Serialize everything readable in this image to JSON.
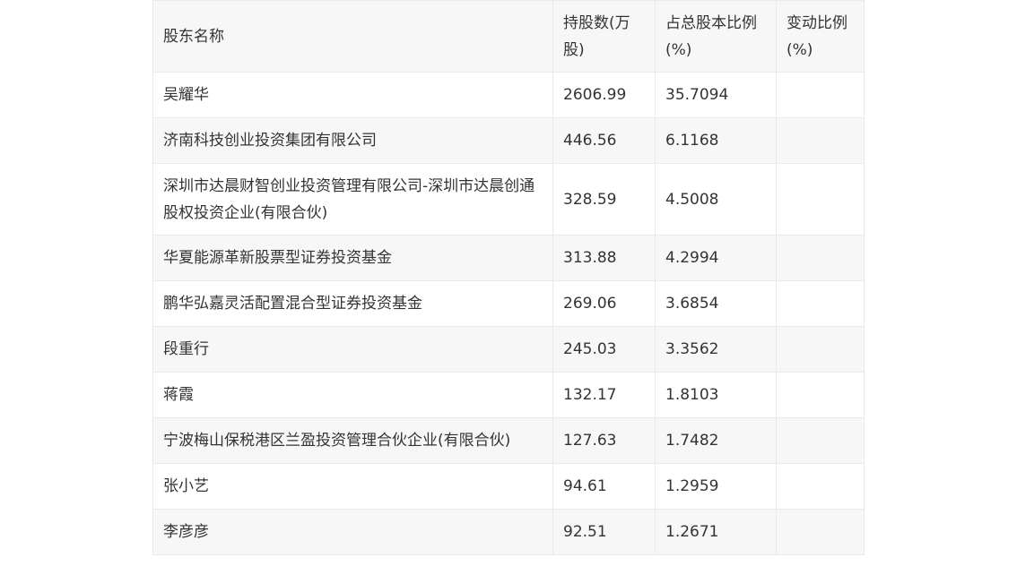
{
  "table": {
    "headers": [
      "股东名称",
      "持股数(万股)",
      "占总股本比例(%)",
      "变动比例(%)"
    ],
    "rows": [
      {
        "name": "吴耀华",
        "shares": "2606.99",
        "ratio": "35.7094",
        "change": ""
      },
      {
        "name": "济南科技创业投资集团有限公司",
        "shares": "446.56",
        "ratio": "6.1168",
        "change": ""
      },
      {
        "name": "深圳市达晨财智创业投资管理有限公司-深圳市达晨创通股权投资企业(有限合伙)",
        "shares": "328.59",
        "ratio": "4.5008",
        "change": ""
      },
      {
        "name": "华夏能源革新股票型证券投资基金",
        "shares": "313.88",
        "ratio": "4.2994",
        "change": ""
      },
      {
        "name": "鹏华弘嘉灵活配置混合型证券投资基金",
        "shares": "269.06",
        "ratio": "3.6854",
        "change": ""
      },
      {
        "name": "段重行",
        "shares": "245.03",
        "ratio": "3.3562",
        "change": ""
      },
      {
        "name": "蒋霞",
        "shares": "132.17",
        "ratio": "1.8103",
        "change": ""
      },
      {
        "name": "宁波梅山保税港区兰盈投资管理合伙企业(有限合伙)",
        "shares": "127.63",
        "ratio": "1.7482",
        "change": ""
      },
      {
        "name": "张小艺",
        "shares": "94.61",
        "ratio": "1.2959",
        "change": ""
      },
      {
        "name": "李彦彦",
        "shares": "92.51",
        "ratio": "1.2671",
        "change": ""
      }
    ]
  }
}
